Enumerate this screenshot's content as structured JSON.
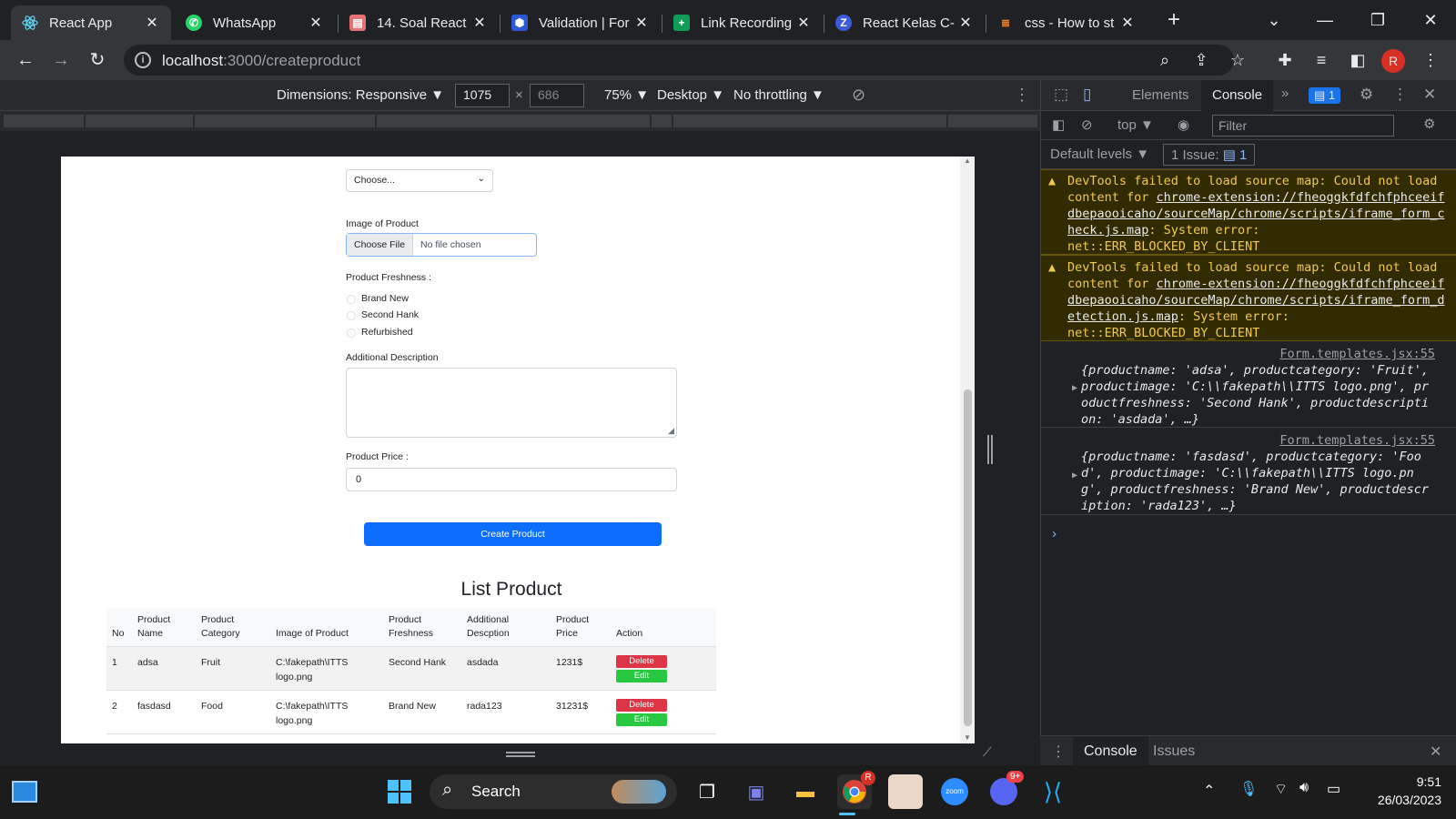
{
  "browser": {
    "tabs": [
      {
        "label": "React App",
        "icon": "react-icon",
        "color": "#61dafb",
        "active": true
      },
      {
        "label": "WhatsApp",
        "icon": "whatsapp-icon",
        "color": "#25d366"
      },
      {
        "label": "14. Soal React",
        "icon": "document-icon",
        "color": "#e57373"
      },
      {
        "label": "Validation | For",
        "icon": "shield-icon",
        "color": "#2c58d6"
      },
      {
        "label": "Link Recording",
        "icon": "sheets-icon",
        "color": "#0f9d58"
      },
      {
        "label": "React Kelas C-",
        "icon": "z-icon",
        "color": "#3b5bdb"
      },
      {
        "label": "css - How to st",
        "icon": "stackoverflow-icon",
        "color": "#f48024"
      }
    ],
    "url_host": "localhost",
    "url_path": ":3000/createproduct",
    "profile_initial": "R"
  },
  "device_toolbar": {
    "dimensions_label": "Dimensions: Responsive",
    "width": "1075",
    "height": "686",
    "zoom": "75%",
    "device_type": "Desktop",
    "throttling": "No throttling"
  },
  "form": {
    "category_select_value": "Choose...",
    "image_label": "Image of Product",
    "file_button": "Choose File",
    "file_status": "No file chosen",
    "freshness_label": "Product Freshness :",
    "freshness_options": [
      "Brand New",
      "Second Hank",
      "Refurbished"
    ],
    "description_label": "Additional Description",
    "price_label": "Product Price :",
    "price_value": "0",
    "submit_label": "Create Product"
  },
  "list": {
    "title": "List Product",
    "headers": [
      "No",
      "Product Name",
      "Product Category",
      "Image of Product",
      "Product Freshness",
      "Additional Descption",
      "Product Price",
      "Action"
    ],
    "rows": [
      {
        "no": "1",
        "name": "adsa",
        "category": "Fruit",
        "image": "C:\\fakepath\\ITTS logo.png",
        "freshness": "Second Hank",
        "description": "asdada",
        "price": "1231$"
      },
      {
        "no": "2",
        "name": "fasdasd",
        "category": "Food",
        "image": "C:\\fakepath\\ITTS logo.png",
        "freshness": "Brand New",
        "description": "rada123",
        "price": "31231$"
      }
    ],
    "delete_label": "Delete",
    "edit_label": "Edit"
  },
  "devtools": {
    "tabs": [
      "Elements",
      "Console"
    ],
    "active_tab": "Console",
    "issues_badge": "1",
    "context": "top",
    "filter_placeholder": "Filter",
    "levels": "Default levels",
    "issues_label": "1 Issue:",
    "issues_count": "1",
    "warnings": [
      {
        "prefix": "DevTools failed to load source map: Could not load content for ",
        "link": "chrome-extension://fheoggkfdfchfphceeifdbepaooicaho/sourceMap/chrome/scripts/iframe_form_check.js.map",
        "suffix": ": System error: net::ERR_BLOCKED_BY_CLIENT"
      },
      {
        "prefix": "DevTools failed to load source map: Could not load content for ",
        "link": "chrome-extension://fheoggkfdfchfphceeifdbepaooicaho/sourceMap/chrome/scripts/iframe_form_detection.js.map",
        "suffix": ": System error: net::ERR_BLOCKED_BY_CLIENT"
      }
    ],
    "logs": [
      {
        "source": "Form.templates.jsx:55",
        "text": "{productname: 'adsa', productcategory: 'Fruit', productimage: 'C:\\\\fakepath\\\\ITTS logo.png', productfreshness: 'Second Hank', productdescription: 'asdada', …}"
      },
      {
        "source": "Form.templates.jsx:55",
        "text": "{productname: 'fasdasd', productcategory: 'Food', productimage: 'C:\\\\fakepath\\\\ITTS logo.png', productfreshness: 'Brand New', productdescription: 'rada123', …}"
      }
    ],
    "drawer_tabs": [
      "Console",
      "Issues"
    ]
  },
  "taskbar": {
    "search_label": "Search",
    "time": "9:51",
    "date": "26/03/2023",
    "chrome_badge": "R",
    "discord_badge": "9+"
  }
}
